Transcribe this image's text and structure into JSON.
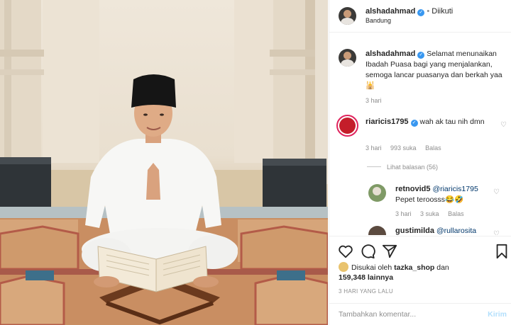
{
  "post": {
    "author": "alshadahmad",
    "follow_status": "Diikuti",
    "location": "Bandung",
    "caption": "Selamat menunaikan Ibadah Puasa bagi yang menjalankan, semoga lancar puasanya dan berkah yaa",
    "caption_emoji": "🕌",
    "caption_time": "3 hari"
  },
  "comments": [
    {
      "user": "riaricis1795",
      "text": "wah ak tau nih dmn",
      "time": "3 hari",
      "likes": "993 suka",
      "reply_label": "Balas",
      "view_replies": "Lihat balasan (56)"
    },
    {
      "user": "retnovid5",
      "mention": "@riaricis1795",
      "text": "Pepet teroosss",
      "emoji": "😂🤣",
      "time": "3 hari",
      "likes": "3 suka",
      "reply_label": "Balas"
    },
    {
      "user": "gustimilda",
      "mention": "@rullarosita"
    }
  ],
  "likes": {
    "prefix": "Disukai oleh",
    "user": "tazka_shop",
    "connector": "dan",
    "count": "159,348",
    "suffix": "lainnya"
  },
  "posted_ago": "3 HARI YANG LALU",
  "add_comment": {
    "placeholder": "Tambahkan komentar...",
    "post_label": "Kirim"
  },
  "colors": {
    "verified": "#3897f0",
    "post_button_disabled": "#b2dffc",
    "muted": "#8e8e8e"
  },
  "icons": [
    "heart-icon",
    "comment-icon",
    "share-icon",
    "bookmark-icon",
    "verified-icon"
  ]
}
